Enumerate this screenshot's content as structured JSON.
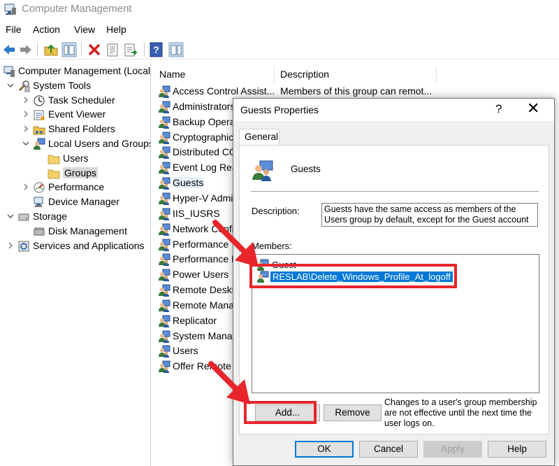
{
  "window": {
    "title": "Computer Management"
  },
  "menu": [
    "File",
    "Action",
    "View",
    "Help"
  ],
  "tree": {
    "items": [
      {
        "label": "Computer Management (Local",
        "level": 0,
        "expander": "",
        "icon": "computer-icon"
      },
      {
        "label": "System Tools",
        "level": 1,
        "expander": "open",
        "icon": "tools-icon"
      },
      {
        "label": "Task Scheduler",
        "level": 2,
        "expander": "closed",
        "icon": "clock-icon"
      },
      {
        "label": "Event Viewer",
        "level": 2,
        "expander": "closed",
        "icon": "event-viewer-icon"
      },
      {
        "label": "Shared Folders",
        "level": 2,
        "expander": "closed",
        "icon": "shared-folder-icon"
      },
      {
        "label": "Local Users and Groups",
        "level": 2,
        "expander": "open",
        "icon": "users-icon"
      },
      {
        "label": "Users",
        "level": 3,
        "expander": "",
        "icon": "folder-icon"
      },
      {
        "label": "Groups",
        "level": 3,
        "expander": "",
        "icon": "folder-icon",
        "selected": true
      },
      {
        "label": "Performance",
        "level": 2,
        "expander": "closed",
        "icon": "performance-icon"
      },
      {
        "label": "Device Manager",
        "level": 2,
        "expander": "",
        "icon": "device-manager-icon"
      },
      {
        "label": "Storage",
        "level": 1,
        "expander": "open",
        "icon": "storage-icon"
      },
      {
        "label": "Disk Management",
        "level": 2,
        "expander": "",
        "icon": "disk-icon"
      },
      {
        "label": "Services and Applications",
        "level": 1,
        "expander": "closed",
        "icon": "services-icon"
      }
    ]
  },
  "list": {
    "columns": [
      "Name",
      "Description"
    ],
    "rows": [
      {
        "name": "Access Control Assist...",
        "desc": "Members of this group can remot..."
      },
      {
        "name": "Administrators",
        "desc": ""
      },
      {
        "name": "Backup Operat",
        "desc": ""
      },
      {
        "name": "Cryptographic",
        "desc": ""
      },
      {
        "name": "Distributed CO",
        "desc": ""
      },
      {
        "name": "Event Log Rea",
        "desc": ""
      },
      {
        "name": "Guests",
        "desc": "",
        "selected": true
      },
      {
        "name": "Hyper-V Admi",
        "desc": ""
      },
      {
        "name": "IIS_IUSRS",
        "desc": ""
      },
      {
        "name": "Network Confi",
        "desc": ""
      },
      {
        "name": "Performance",
        "desc": ""
      },
      {
        "name": "Performance M",
        "desc": ""
      },
      {
        "name": "Power Users",
        "desc": ""
      },
      {
        "name": "Remote Deskto",
        "desc": ""
      },
      {
        "name": "Remote Manag",
        "desc": ""
      },
      {
        "name": "Replicator",
        "desc": ""
      },
      {
        "name": "System Manag",
        "desc": ""
      },
      {
        "name": "Users",
        "desc": ""
      },
      {
        "name": "Offer Remote A",
        "desc": ""
      }
    ]
  },
  "dialog": {
    "title": "Guests Properties",
    "help": "?",
    "close": "✕",
    "tab": "General",
    "group_name": "Guests",
    "description_label": "Description:",
    "description": "Guests have the same access as members of the Users group by default, except for the Guest account which is",
    "members_label": "Members:",
    "members": [
      {
        "name": "Guest",
        "selected": false
      },
      {
        "name": "RESLAB\\Delete_Windows_Profile_At_logoff",
        "selected": true
      }
    ],
    "add_label": "Add...",
    "remove_label": "Remove",
    "note": "Changes to a user's group membership are not effective until the next time the user logs on.",
    "ok_label": "OK",
    "cancel_label": "Cancel",
    "apply_label": "Apply",
    "help_label": "Help"
  },
  "colors": {
    "annotation": "#e8252b",
    "selection": "#0078d7"
  }
}
